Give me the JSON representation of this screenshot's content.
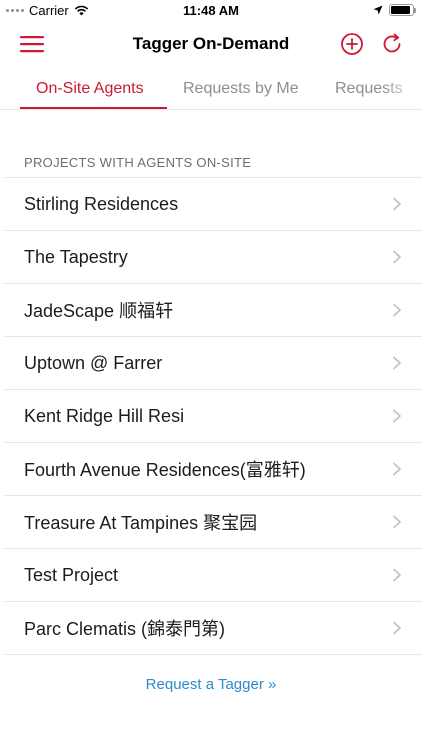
{
  "status_bar": {
    "carrier": "Carrier",
    "time": "11:48 AM",
    "battery_level": 0.9
  },
  "nav": {
    "title": "Tagger On-Demand",
    "icons": {
      "menu": "menu-icon",
      "add": "add-circle-icon",
      "refresh": "refresh-icon"
    }
  },
  "tabs": [
    {
      "label": "On-Site Agents",
      "active": true
    },
    {
      "label": "Requests by Me",
      "active": false
    },
    {
      "label": "Requests",
      "active": false
    }
  ],
  "section": {
    "header": "PROJECTS WITH AGENTS ON-SITE",
    "items": [
      "Stirling Residences",
      "The Tapestry",
      "JadeScape 顺福轩",
      "Uptown @ Farrer",
      "Kent Ridge Hill Resi",
      "Fourth Avenue Residences(富雅轩)",
      "Treasure At Tampines 聚宝园",
      "Test Project",
      "Parc Clematis (錦泰門第)"
    ]
  },
  "footer": {
    "request_link": "Request a Tagger »"
  },
  "colors": {
    "accent": "#cc1a36",
    "link": "#2b8ccf",
    "inactive_tab": "#8e8e93"
  }
}
